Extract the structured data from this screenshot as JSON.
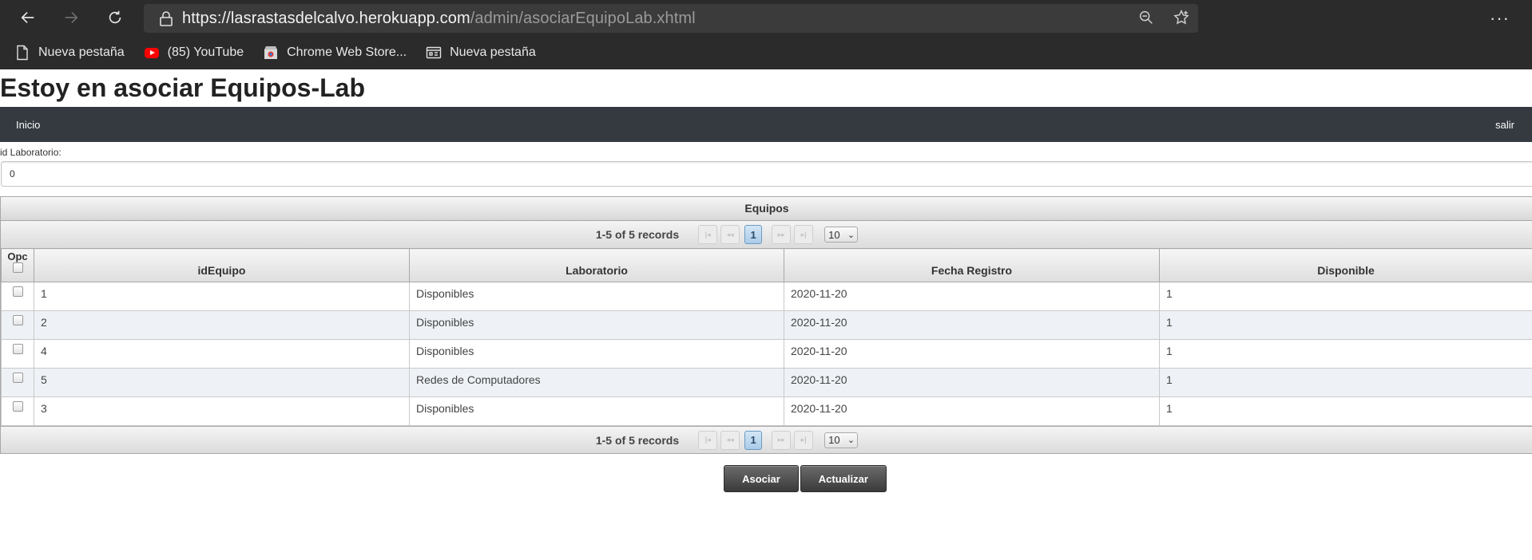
{
  "browser": {
    "url_host": "https://lasrastasdelcalvo.herokuapp.com",
    "url_path": "/admin/asociarEquipoLab.xhtml",
    "menu": "···",
    "bookmarks": [
      {
        "label": "Nueva pestaña",
        "icon": "page-icon"
      },
      {
        "label": "(85) YouTube",
        "icon": "youtube-icon"
      },
      {
        "label": "Chrome Web Store...",
        "icon": "webstore-icon"
      },
      {
        "label": "Nueva pestaña",
        "icon": "tabs-icon"
      }
    ]
  },
  "page": {
    "title": "Estoy en asociar Equipos-Lab",
    "menu": {
      "home": "Inicio",
      "logout": "salir"
    },
    "form": {
      "label": "id Laboratorio:",
      "value": "0"
    }
  },
  "table": {
    "caption": "Equipos",
    "paginator": {
      "report": "1-5 of 5 records",
      "page": "1",
      "rows_per_page": "10"
    },
    "columns": [
      "Opc",
      "idEquipo",
      "Laboratorio",
      "Fecha Registro",
      "Disponible"
    ],
    "rows": [
      [
        "1",
        "Disponibles",
        "2020-11-20",
        "1"
      ],
      [
        "2",
        "Disponibles",
        "2020-11-20",
        "1"
      ],
      [
        "4",
        "Disponibles",
        "2020-11-20",
        "1"
      ],
      [
        "5",
        "Redes de Computadores",
        "2020-11-20",
        "1"
      ],
      [
        "3",
        "Disponibles",
        "2020-11-20",
        "1"
      ]
    ]
  },
  "actions": {
    "associate": "Asociar",
    "refresh": "Actualizar"
  },
  "colors": {
    "chrome_bg": "#2b2b2b",
    "menubar_bg": "#343a40",
    "accent": "#a9cbe8"
  }
}
